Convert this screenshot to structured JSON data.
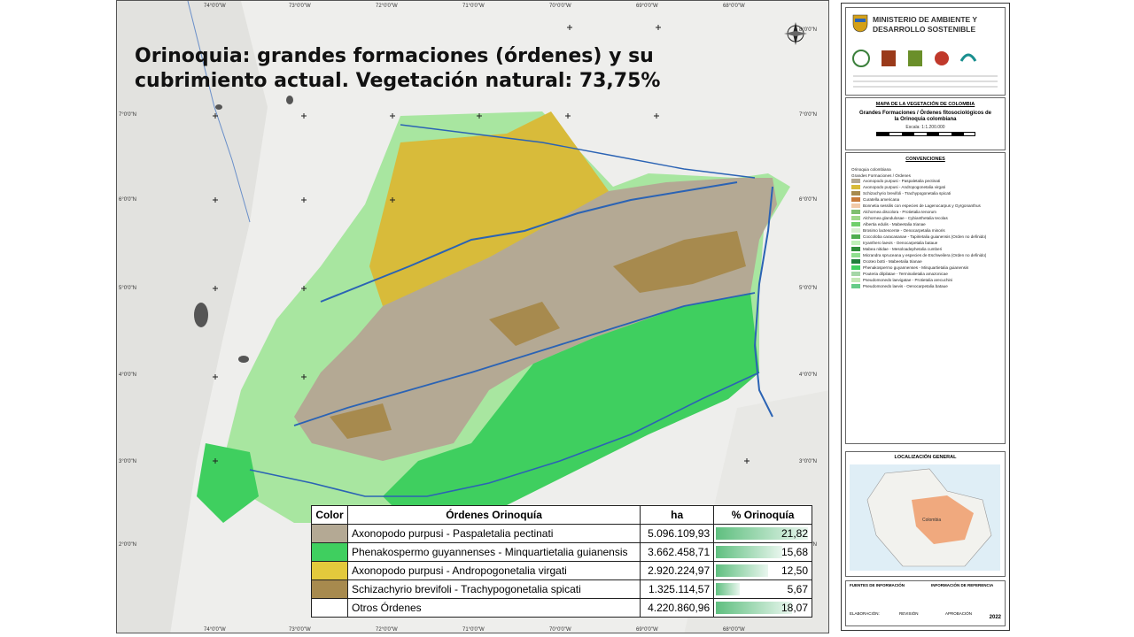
{
  "slide": {
    "title": "Orinoquia: grandes formaciones (órdenes) y su cubrimiento actual. Vegetación natural: 73,75%"
  },
  "map": {
    "top_ticks": [
      "74°0'0\"W",
      "73°0'0\"W",
      "72°0'0\"W",
      "71°0'0\"W",
      "70°0'0\"W",
      "69°0'0\"W",
      "68°0'0\"W"
    ],
    "bottom_ticks": [
      "74°0'0\"W",
      "73°0'0\"W",
      "72°0'0\"W",
      "71°0'0\"W",
      "70°0'0\"W",
      "69°0'0\"W",
      "68°0'0\"W"
    ],
    "left_ticks": [
      "7°0'0\"N",
      "6°0'0\"N",
      "5°0'0\"N",
      "4°0'0\"N",
      "3°0'0\"N",
      "2°0'0\"N"
    ],
    "right_ticks": [
      "8°0'0\"N",
      "7°0'0\"N",
      "6°0'0\"N",
      "5°0'0\"N",
      "4°0'0\"N",
      "3°0'0\"N",
      "2°0'0\"N"
    ],
    "colors": {
      "paspaletalia": "#b4a994",
      "minquartietalia": "#3fcf5f",
      "andropogonetalia": "#d8bb3a",
      "trachypogonetalia": "#b19350",
      "otros": "#9fe39a",
      "background_land": "#e6e6e2",
      "river": "#2b63b4",
      "city": "#555555"
    }
  },
  "legend_table": {
    "headers": [
      "Color",
      "Órdenes Orinoquía",
      "ha",
      "% Orinoquía"
    ],
    "rows": [
      {
        "color": "#b4a994",
        "name": "Axonopodo purpusi - Paspaletalia pectinati",
        "ha": "5.096.109,93",
        "pct_label": "21,82",
        "pct": 21.82
      },
      {
        "color": "#3fcf5f",
        "name": "Phenakospermo guyannenses - Minquartietalia guianensis",
        "ha": "3.662.458,71",
        "pct_label": "15,68",
        "pct": 15.68
      },
      {
        "color": "#e3c93c",
        "name": "Axonopodo purpusi - Andropogonetalia virgati",
        "ha": "2.920.224,97",
        "pct_label": "12,50",
        "pct": 12.5
      },
      {
        "color": "#a78a4e",
        "name": "Schizachyrio brevifoli - Trachypogonetalia spicati",
        "ha": "1.325.114,57",
        "pct_label": "5,67",
        "pct": 5.67
      },
      {
        "color": "#ffffff",
        "name": "Otros Órdenes",
        "ha": "4.220.860,96",
        "pct_label": "18,07",
        "pct": 18.07
      }
    ]
  },
  "side_panel": {
    "ministry_line1": "MINISTERIO DE AMBIENTE Y",
    "ministry_line2": "DESARROLLO SOSTENIBLE",
    "map_title": "MAPA DE LA VEGETACIÓN DE COLOMBIA",
    "subtitle_line1": "Grandes Formaciones / Órdenes fitosociológicos de",
    "subtitle_line2": "la Orinoquia colombiana",
    "scale": "Escala: 1:1.200.000",
    "conventions_title": "CONVENCIONES",
    "legend_group1": "Orinoquia colombiana",
    "legend_group2": "Grandes Formaciones / Órdenes",
    "legend_items": [
      {
        "color": "#b4a994",
        "label": "Axonopodo purpusi - Paspaletalia pectinati"
      },
      {
        "color": "#d8bb3a",
        "label": "Axonopodo purpusi - Andropogonetalia virgati"
      },
      {
        "color": "#a78a4e",
        "label": "Schizachyrio brevifoli - Trachypogonetalia spicati"
      },
      {
        "color": "#c87a3a",
        "label": "Curatella americana"
      },
      {
        "color": "#f1c9a8",
        "label": "Bonnetia sessilis con especies de Lagenocarpus y Gyrgonanthus"
      },
      {
        "color": "#7fbf6f",
        "label": "Alchornea discolora - Protietalia tenorum"
      },
      {
        "color": "#9fd88a",
        "label": "Alchornea glandulosae - Cybianthetalia tecolas"
      },
      {
        "color": "#6fcf6a",
        "label": "Albertia edulis - Mabeetalia trianae"
      },
      {
        "color": "#d7efcf",
        "label": "Brosimo lactescente - Oenocarpetalia minoris"
      },
      {
        "color": "#4fae4f",
        "label": "Coccoloba caracasanae - Tapirietalia guianensis (Orden no definido)"
      },
      {
        "color": "#bff0b8",
        "label": "Iryanthero laevis - Oenocarpetalia bataue"
      },
      {
        "color": "#2f8f3a",
        "label": "Mabea nitidae - Mesoloadephetalia cumberi"
      },
      {
        "color": "#8fe08f",
        "label": "Micrandra spruceana y especies de Eschweilera (Orden no definido)"
      },
      {
        "color": "#1f7f3a",
        "label": "Ocoteo botti - Mabeetalia trianae"
      },
      {
        "color": "#3fcf5f",
        "label": "Phenakospermo guyannenses - Minquartietalia guianensis"
      },
      {
        "color": "#a5d6a7",
        "label": "Pouteria dilpilatae - Terminalietalia amazonicae"
      },
      {
        "color": "#c5e8b7",
        "label": "Pseudomonedo laevigatae - Protietalia arecuchini"
      },
      {
        "color": "#66cc88",
        "label": "Pseudomonedo laevis - Oenocarpetalia bataue"
      }
    ],
    "location_title": "LOCALIZACIÓN GENERAL",
    "location_label": "Colombia",
    "footer_col1": "FUENTES DE INFORMACIÓN",
    "footer_col2": "INFORMACIÓN DE REFERENCIA",
    "elab_label": "ELABORACIÓN:",
    "revision_label": "REVISIÓN",
    "approval_label": "APROBACIÓN",
    "year": "2022"
  }
}
